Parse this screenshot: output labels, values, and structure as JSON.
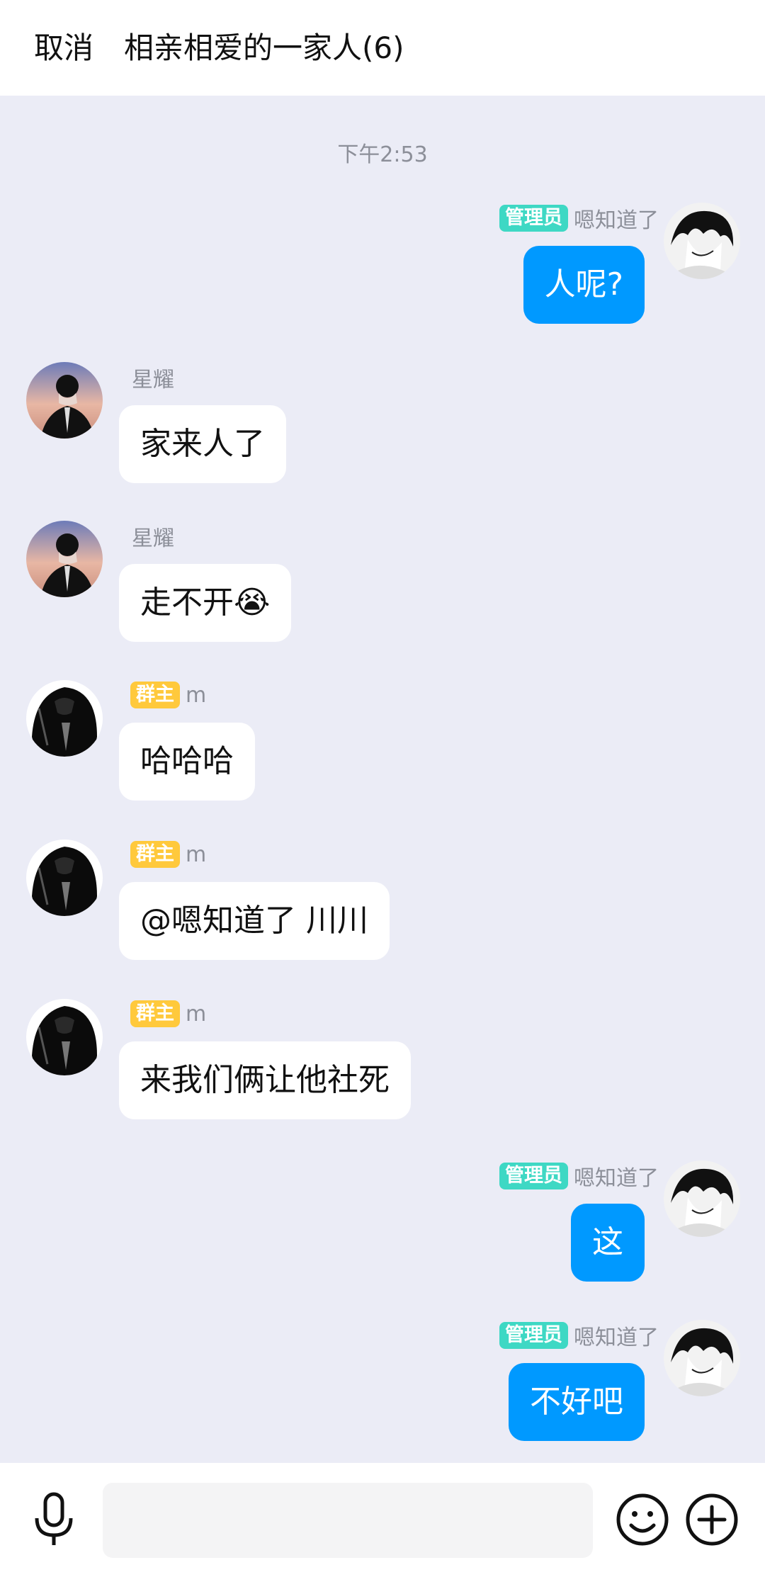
{
  "header": {
    "cancel_label": "取消",
    "title": "相亲相爱的一家人(6)"
  },
  "chat": {
    "timestamp": "下午2:53",
    "messages": [
      {
        "direction": "out",
        "badge": "管理员",
        "sender": "嗯知道了",
        "text": "人呢?"
      },
      {
        "direction": "in",
        "badge": "",
        "sender": "星耀",
        "text": "家来人了"
      },
      {
        "direction": "in",
        "badge": "",
        "sender": "星耀",
        "text": "走不开😭"
      },
      {
        "direction": "in",
        "badge": "群主",
        "sender": "m",
        "text": "哈哈哈"
      },
      {
        "direction": "in",
        "badge": "群主",
        "sender": "m",
        "text": "@嗯知道了 川川"
      },
      {
        "direction": "in",
        "badge": "群主",
        "sender": "m",
        "text": "来我们俩让他社死"
      },
      {
        "direction": "out",
        "badge": "管理员",
        "sender": "嗯知道了",
        "text": "这"
      },
      {
        "direction": "out",
        "badge": "管理员",
        "sender": "嗯知道了",
        "text": "不好吧"
      }
    ]
  },
  "composer": {
    "input_value": "",
    "icons": [
      "microphone-icon",
      "emoji-icon",
      "plus-icon"
    ]
  },
  "colors": {
    "outgoing_bubble": "#0099ff",
    "admin_badge": "#3ed8c4",
    "owner_badge": "#ffc93c",
    "chat_background": "#ebecf6"
  }
}
